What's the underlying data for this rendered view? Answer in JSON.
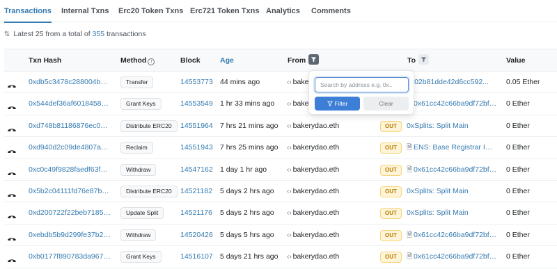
{
  "tabs": [
    {
      "label": "Transactions",
      "active": true
    },
    {
      "label": "Internal Txns",
      "active": false
    },
    {
      "label": "Erc20 Token Txns",
      "active": false
    },
    {
      "label": "Erc721 Token Txns",
      "active": false
    },
    {
      "label": "Analytics",
      "active": false
    },
    {
      "label": "Comments",
      "active": false
    }
  ],
  "summary": {
    "prefix": "Latest 25 from a total of",
    "count": "355",
    "suffix": "transactions"
  },
  "table": {
    "headers": {
      "txn_hash": "Txn Hash",
      "method": "Method",
      "block": "Block",
      "age": "Age",
      "from": "From",
      "to": "To",
      "value": "Value"
    },
    "rows": [
      {
        "hash": "0xdb5c3478c288004bc5...",
        "method": "Transfer",
        "block": "14553773",
        "age": "44 mins ago",
        "from": "bakerydao.eth",
        "direction": "",
        "to": "0x02b81dde42d6cc592...",
        "to_contract": false,
        "value": "0.05 Ether"
      },
      {
        "hash": "0x544def36af601845856...",
        "method": "Grant Keys",
        "block": "14553549",
        "age": "1 hr 33 mins ago",
        "from": "bakerydao.eth",
        "direction": "",
        "to": "0x61cc42c66ba9df72bf6...",
        "to_contract": true,
        "value": "0 Ether"
      },
      {
        "hash": "0xd748b81186876ec07d...",
        "method": "Distribute ERC20",
        "block": "14551964",
        "age": "7 hrs 21 mins ago",
        "from": "bakerydao.eth",
        "direction": "OUT",
        "to": "0xSplits: Split Main",
        "to_contract": false,
        "value": "0 Ether"
      },
      {
        "hash": "0xd940d2c09de4807a2b...",
        "method": "Reclaim",
        "block": "14551943",
        "age": "7 hrs 25 mins ago",
        "from": "bakerydao.eth",
        "direction": "OUT",
        "to": "ENS: Base Registrar Imp...",
        "to_contract": true,
        "value": "0 Ether"
      },
      {
        "hash": "0xc0c49f9828faedf63fc5...",
        "method": "Withdraw",
        "block": "14547162",
        "age": "1 day 1 hr ago",
        "from": "bakerydao.eth",
        "direction": "OUT",
        "to": "0x61cc42c66ba9df72bf6...",
        "to_contract": true,
        "value": "0 Ether"
      },
      {
        "hash": "0x5b2c04111fd76e87b31...",
        "method": "Distribute ERC20",
        "block": "14521182",
        "age": "5 days 2 hrs ago",
        "from": "bakerydao.eth",
        "direction": "OUT",
        "to": "0xSplits: Split Main",
        "to_contract": false,
        "value": "0 Ether"
      },
      {
        "hash": "0xd200722f22beb7185fd...",
        "method": "Update Split",
        "block": "14521176",
        "age": "5 days 2 hrs ago",
        "from": "bakerydao.eth",
        "direction": "OUT",
        "to": "0xSplits: Split Main",
        "to_contract": false,
        "value": "0 Ether"
      },
      {
        "hash": "0xebdb5b9d299fe37b26...",
        "method": "Withdraw",
        "block": "14520426",
        "age": "5 days 5 hrs ago",
        "from": "bakerydao.eth",
        "direction": "OUT",
        "to": "0x61cc42c66ba9df72bf6...",
        "to_contract": true,
        "value": "0 Ether"
      },
      {
        "hash": "0xb0177f890783da967a...",
        "method": "Grant Keys",
        "block": "14516107",
        "age": "5 days 21 hrs ago",
        "from": "bakerydao.eth",
        "direction": "OUT",
        "to": "0x61cc42c66ba9df72bf6...",
        "to_contract": true,
        "value": "0 Ether"
      }
    ]
  },
  "filter_popover": {
    "placeholder": "Search by address e.g. 0x..",
    "filter_label": "Filter",
    "clear_label": "Clear"
  },
  "colors": {
    "accent": "#357ab0",
    "out_badge": "#b47d00",
    "filter_button": "#3d7fd6"
  },
  "icons": [
    "sort-icon",
    "info-icon",
    "filter-icon",
    "eye-icon",
    "chain-link-icon",
    "contract-doc-icon"
  ]
}
